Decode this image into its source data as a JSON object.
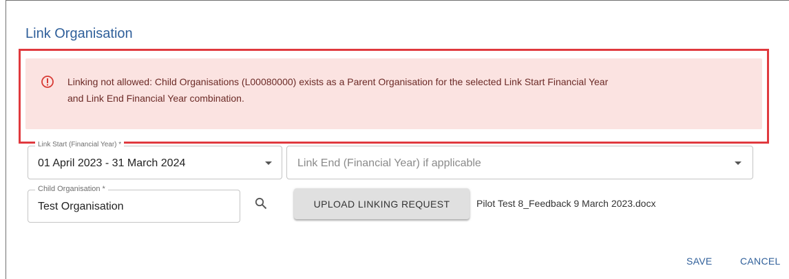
{
  "dialog": {
    "title": "Link Organisation"
  },
  "alert": {
    "icon": "error-circle-icon",
    "message_line1": "Linking not allowed: Child Organisations (L00080000) exists as a Parent Organisation for the selected Link Start Financial Year",
    "message_line2": "and Link End Financial Year combination."
  },
  "form": {
    "link_start": {
      "label": "Link Start (Financial Year) *",
      "value": "01 April 2023 - 31 March 2024"
    },
    "link_end": {
      "placeholder": "Link End (Financial Year) if applicable",
      "value": ""
    },
    "child_org": {
      "label": "Child Organisation *",
      "value": "Test Organisation"
    },
    "upload_button": "UPLOAD LINKING REQUEST",
    "uploaded_file": "Pilot Test 8_Feedback 9 March 2023.docx"
  },
  "actions": {
    "save": "SAVE",
    "cancel": "CANCEL"
  },
  "colors": {
    "title": "#2f5f9a",
    "alert_bg": "#fbe3e1",
    "alert_border_highlight": "#e0393e",
    "alert_text": "#6b2a26"
  }
}
